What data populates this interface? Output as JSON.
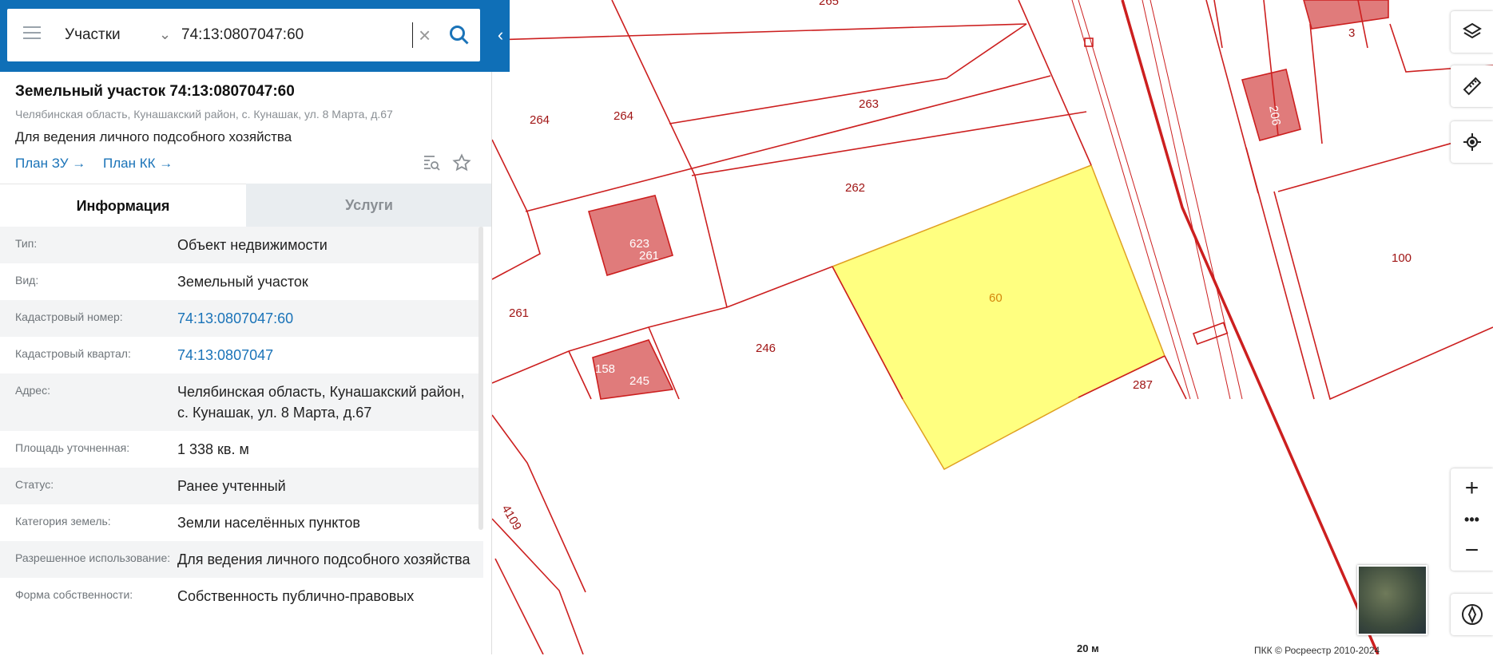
{
  "search": {
    "type_label": "Участки",
    "value": "74:13:0807047:60"
  },
  "object": {
    "title": "Земельный участок 74:13:0807047:60",
    "address": "Челябинская область, Кунашакский район, с. Кунашак, ул. 8 Марта, д.67",
    "purpose": "Для ведения личного подсобного хозяйства",
    "links": [
      "План ЗУ →",
      "План КК →"
    ]
  },
  "tabs": [
    "Информация",
    "Услуги"
  ],
  "info_rows": [
    {
      "key": "Тип:",
      "value": "Объект недвижимости"
    },
    {
      "key": "Вид:",
      "value": "Земельный участок"
    },
    {
      "key": "Кадастровый номер:",
      "value": "74:13:0807047:60"
    },
    {
      "key": "Кадастровый квартал:",
      "value": "74:13:0807047"
    },
    {
      "key": "Адрес:",
      "value": "Челябинская область, Кунашакский район, с. Кунашак, ул. 8 Марта, д.67"
    },
    {
      "key": "Площадь уточненная:",
      "value": "1 338 кв. м"
    },
    {
      "key": "Статус:",
      "value": "Ранее учтенный"
    },
    {
      "key": "Категория земель:",
      "value": "Земли населённых пунктов"
    },
    {
      "key": "Разрешенное использование:",
      "value": "Для ведения личного подсобного хозяйства"
    },
    {
      "key": "Форма собственности:",
      "value": "Собственность публично-правовых"
    }
  ],
  "map": {
    "parcel_labels": [
      "265",
      "264",
      "264",
      "263",
      "262",
      "623",
      "261",
      "261",
      "246",
      "158",
      "245",
      "60",
      "287",
      "3",
      "206",
      "100",
      "4109"
    ],
    "scale": "20 м",
    "copyright": "ПКК © Росреестр 2010-2024",
    "colors": {
      "boundary": "#cc1f1f",
      "selected_fill": "#ffff80",
      "building_fill": "#e07b7b",
      "header_blue": "#0f6fb7"
    }
  },
  "controls": [
    "layers-icon",
    "ruler-icon",
    "locate-icon",
    "zoom-in-icon",
    "more-icon",
    "zoom-out-icon",
    "compass-icon"
  ]
}
